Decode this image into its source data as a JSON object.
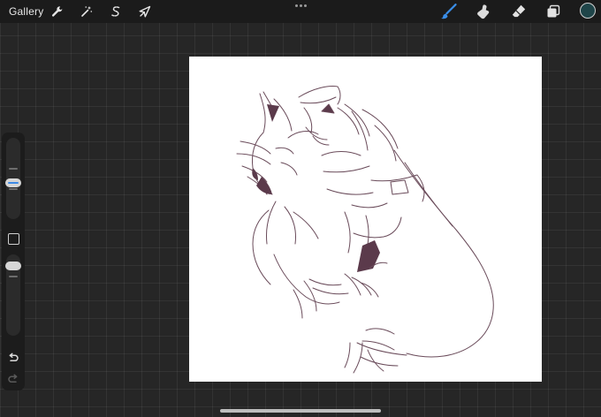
{
  "topbar": {
    "gallery_label": "Gallery",
    "icons": {
      "actions": "wrench-icon",
      "adjustments": "magic-wand-icon",
      "selection": "selection-s-icon",
      "transform": "arrow-cursor-icon",
      "more": "more-dots-icon",
      "brush": "brush-icon",
      "smudge": "smudge-icon",
      "eraser": "eraser-icon",
      "layers": "layers-icon"
    },
    "current_color": "#1f4549",
    "active_tool_color": "#3a8ee8"
  },
  "sidebar": {
    "brush_size_slider": "brush-size-slider",
    "opacity_slider": "opacity-slider",
    "modify_button": "square-icon",
    "undo": "undo-icon",
    "redo": "redo-icon"
  },
  "canvas": {
    "background": "#ffffff",
    "sketch_color": "#6a4b5a",
    "sketch_fill": "#5b3a4b"
  }
}
